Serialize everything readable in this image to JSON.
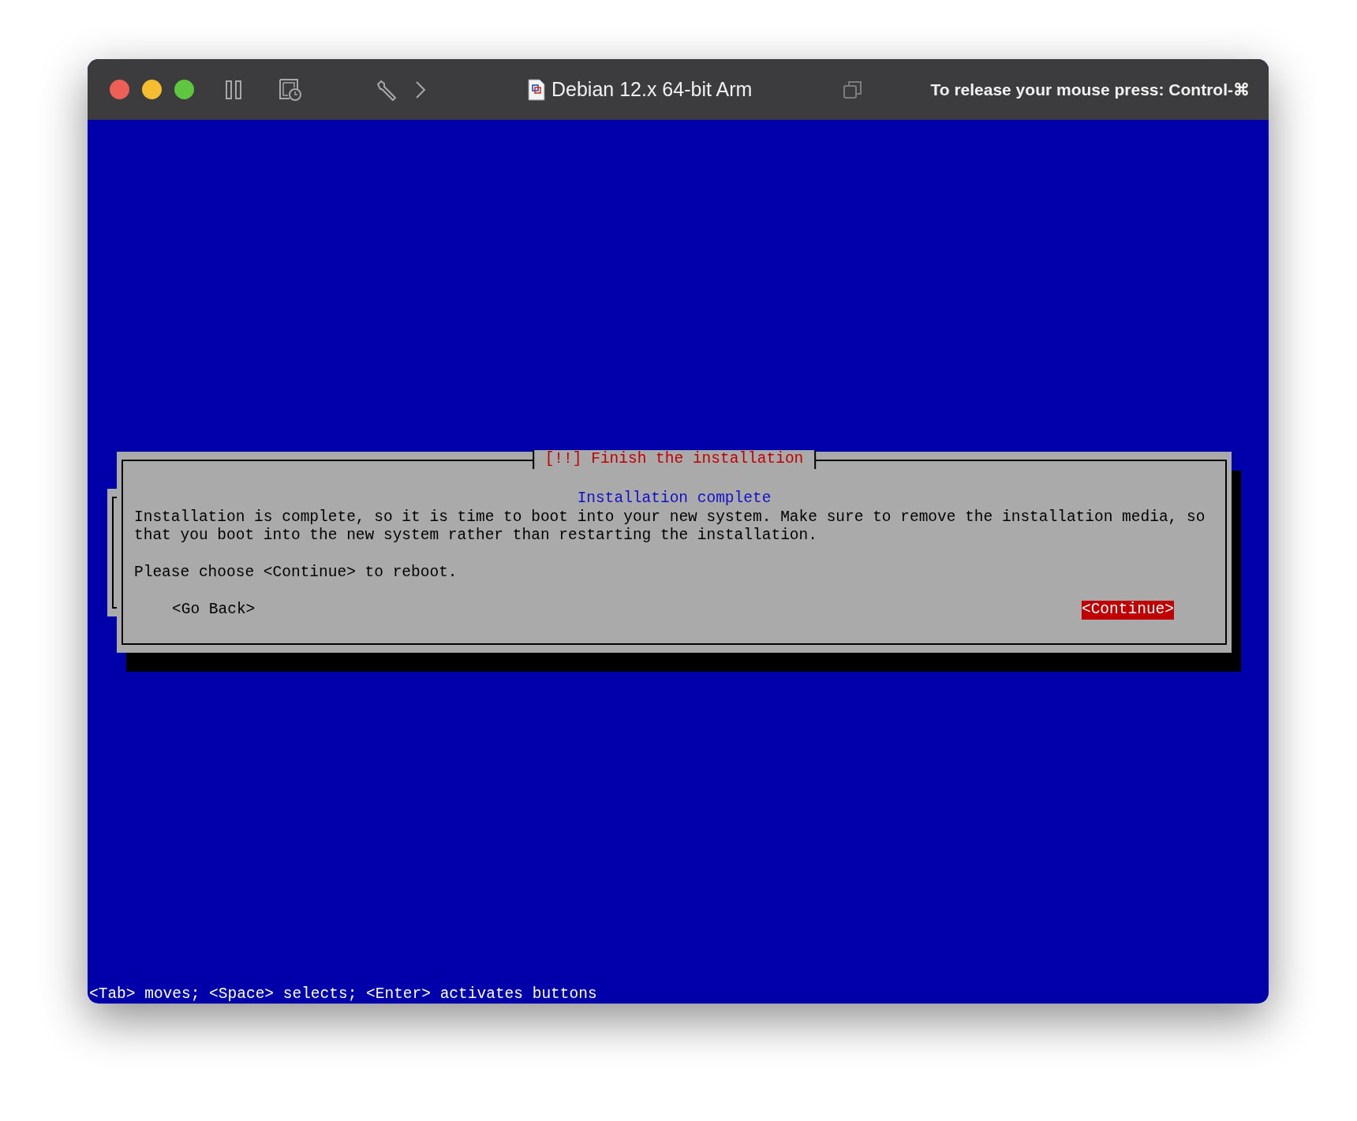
{
  "window": {
    "title": "Debian 12.x 64-bit Arm",
    "release_hint": "To release your mouse press: Control-⌘"
  },
  "dialog": {
    "title": "[!!] Finish the installation",
    "subtitle": "Installation complete",
    "message": "Installation is complete, so it is time to boot into your new system. Make sure to remove the installation media, so that you boot into the new system rather than restarting the installation.",
    "prompt": "Please choose <Continue> to reboot.",
    "buttons": [
      {
        "label": "<Go Back>",
        "selected": false
      },
      {
        "label": "<Continue>",
        "selected": true
      }
    ]
  },
  "status_line": "<Tab> moves; <Space> selects; <Enter> activates buttons"
}
